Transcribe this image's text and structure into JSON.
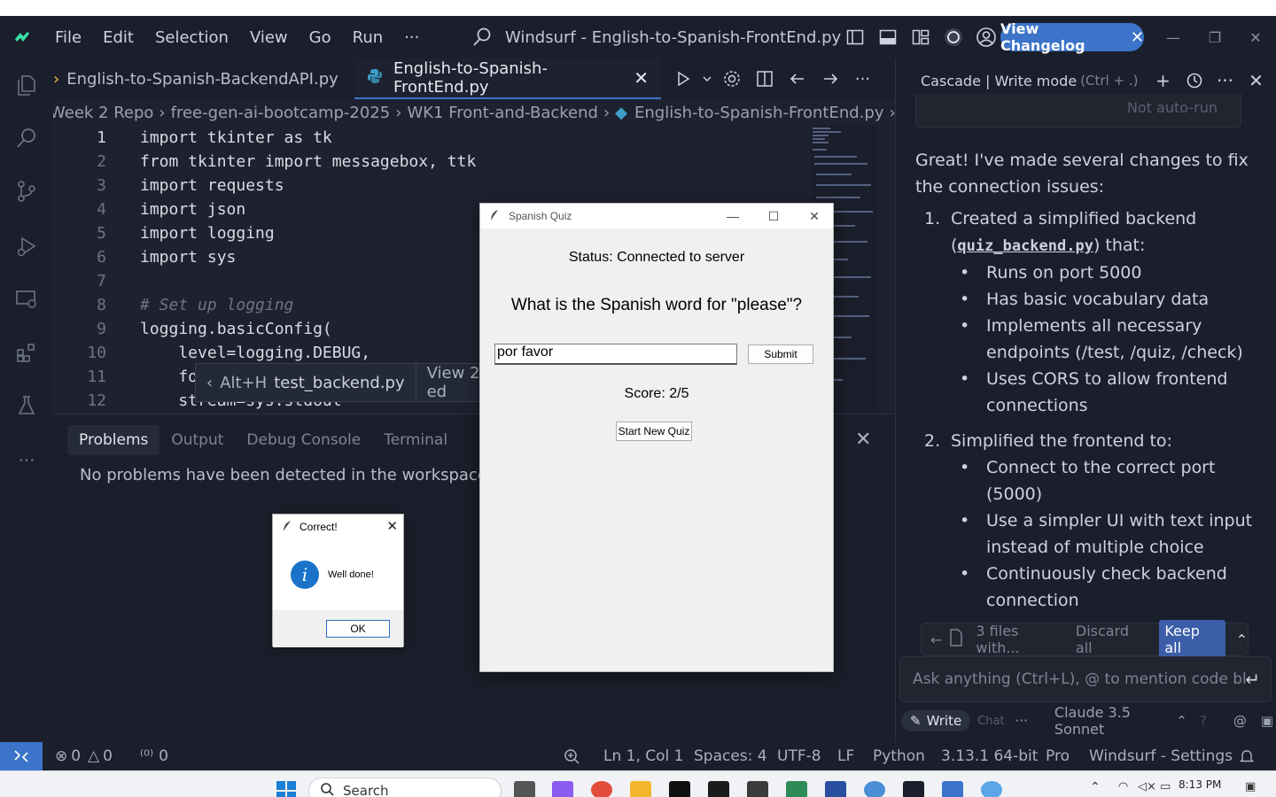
{
  "window": {
    "title": "Windsurf - English-to-Spanish-FrontEnd.py",
    "changelog_label": "View Changelog",
    "menu": [
      "File",
      "Edit",
      "Selection",
      "View",
      "Go",
      "Run",
      "···"
    ]
  },
  "tabs": [
    {
      "label": "English-to-Spanish-BackendAPI.py",
      "active": false
    },
    {
      "label": "English-to-Spanish-FrontEnd.py",
      "active": true
    }
  ],
  "breadcrumb": [
    "Week 2 Repo",
    "free-gen-ai-bootcamp-2025",
    "WK1 Front-and-Backend",
    "English-to-Spanish-FrontEnd.py",
    "..."
  ],
  "code_lines": [
    {
      "n": "1",
      "text": "import tkinter as tk"
    },
    {
      "n": "2",
      "text": "from tkinter import messagebox, ttk"
    },
    {
      "n": "3",
      "text": "import requests"
    },
    {
      "n": "4",
      "text": "import json"
    },
    {
      "n": "5",
      "text": "import logging"
    },
    {
      "n": "6",
      "text": "import sys"
    },
    {
      "n": "7",
      "text": ""
    },
    {
      "n": "8",
      "text": "# Set up logging"
    },
    {
      "n": "9",
      "text": "logging.basicConfig("
    },
    {
      "n": "10",
      "text": "    level=logging.DEBUG,"
    },
    {
      "n": "11",
      "text": "    fo"
    },
    {
      "n": "12",
      "text": "    stream=sys.stdout"
    }
  ],
  "hover_hint": {
    "shortcut": "Alt+H",
    "file": "test_backend.py",
    "view": "View 2 ed"
  },
  "panel": {
    "tabs": [
      "Problems",
      "Output",
      "Debug Console",
      "Terminal"
    ],
    "message": "No problems have been detected in the workspace."
  },
  "cascade": {
    "title": "Cascade | Write mode",
    "shortcut": "(Ctrl + .)",
    "autorun": "Not auto-run",
    "intro": "Great! I've made several changes to fix the connection issues:",
    "steps": [
      {
        "num": "1.",
        "lead": "Created a simplified backend (",
        "code": "quiz_backend.py",
        "trail": ") that:",
        "bullets": [
          "Runs on port 5000",
          "Has basic vocabulary data",
          "Implements all necessary endpoints (/test, /quiz, /check)",
          "Uses CORS to allow frontend connections"
        ]
      },
      {
        "num": "2.",
        "lead": "Simplified the frontend to:",
        "code": "",
        "trail": "",
        "bullets": [
          "Connect to the correct port (5000)",
          "Use a simpler UI with text input instead of multiple choice",
          "Continuously check backend connection"
        ]
      }
    ],
    "files_text": "3 files with...",
    "discard_label": "Discard all",
    "keep_label": "Keep all",
    "input_placeholder": "Ask anything (Ctrl+L), @ to mention code bl",
    "write_label": "Write",
    "chat_label": "Chat",
    "model": "Claude 3.5 Sonnet"
  },
  "statusbar": {
    "errors": "0",
    "warnings": "0",
    "ports": "0",
    "position": "Ln 1, Col 1",
    "spaces": "Spaces: 4",
    "encoding": "UTF-8",
    "eol": "LF",
    "language": "Python",
    "version": "3.13.1 64-bit",
    "pro": "Pro",
    "settings": "Windsurf - Settings"
  },
  "taskbar": {
    "search_placeholder": "Search",
    "time": "8:13 PM"
  },
  "quiz": {
    "title": "Spanish Quiz",
    "status": "Status: Connected to server",
    "question": "What is the Spanish word for \"please\"?",
    "answer": "por favor",
    "submit_label": "Submit",
    "score": "Score: 2/5",
    "new_quiz_label": "Start New Quiz"
  },
  "dialog": {
    "title": "Correct!",
    "message": "Well done!",
    "ok_label": "OK"
  }
}
